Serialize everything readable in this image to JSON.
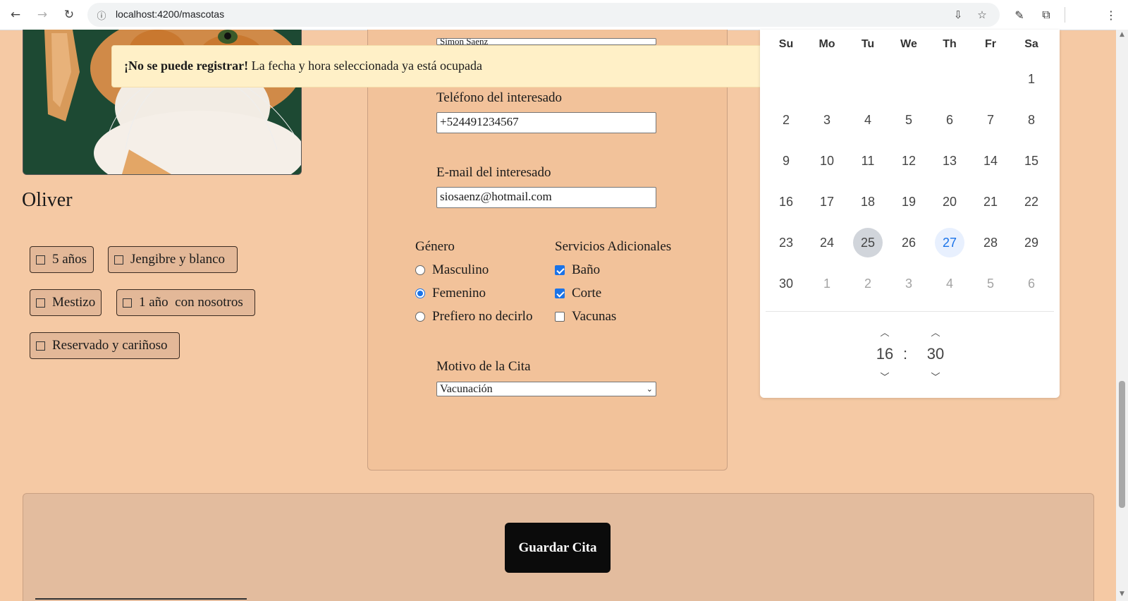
{
  "browser": {
    "url": "localhost:4200/mascotas",
    "back_glyph": "←",
    "forward_glyph": "→",
    "reload_glyph": "↻",
    "info_glyph": "ⓘ",
    "install_glyph": "⇩",
    "bookmark_glyph": "☆",
    "eyedropper_glyph": "✎",
    "extensions_glyph": "⧉",
    "menu_glyph": "⋮",
    "icons": [
      "back-icon",
      "forward-icon",
      "reload-icon",
      "site-info-icon",
      "install-icon",
      "bookmark-star-icon",
      "eyedropper-icon",
      "extensions-icon",
      "menu-icon"
    ]
  },
  "pet": {
    "name": "Oliver",
    "traits": [
      "5 años",
      "Jengibre y blanco",
      "Mestizo",
      "1 año  con nosotros",
      "Reservado y cariñoso"
    ]
  },
  "alert": {
    "title": "¡No se puede registrar!",
    "message": "La fecha y hora seleccionada ya está ocupada",
    "close_glyph": "✕",
    "color_bg": "#fff0c7"
  },
  "form": {
    "partial_value": "Simon Saenz",
    "phone_label": "Teléfono del interesado",
    "phone_value": "+524491234567",
    "email_label": "E-mail del interesado",
    "email_value": "siosaenz@hotmail.com",
    "gender_label": "Género",
    "gender_options": [
      {
        "label": "Masculino",
        "checked": false
      },
      {
        "label": "Femenino",
        "checked": true
      },
      {
        "label": "Prefiero no decirlo",
        "checked": false
      }
    ],
    "services_label": "Servicios Adicionales",
    "services_options": [
      {
        "label": "Baño",
        "checked": true
      },
      {
        "label": "Corte",
        "checked": true
      },
      {
        "label": "Vacunas",
        "checked": false
      }
    ],
    "reason_label": "Motivo de la Cita",
    "reason_value": "Vacunación",
    "reason_chevron": "⌄"
  },
  "calendar": {
    "weekdays": [
      "Su",
      "Mo",
      "Tu",
      "We",
      "Th",
      "Fr",
      "Sa"
    ],
    "weeks": [
      [
        "",
        "",
        "",
        "",
        "",
        "",
        "1"
      ],
      [
        "2",
        "3",
        "4",
        "5",
        "6",
        "7",
        "8"
      ],
      [
        "9",
        "10",
        "11",
        "12",
        "13",
        "14",
        "15"
      ],
      [
        "16",
        "17",
        "18",
        "19",
        "20",
        "21",
        "22"
      ],
      [
        "23",
        "24",
        "25",
        "26",
        "27",
        "28",
        "29"
      ],
      [
        "30",
        "1",
        "2",
        "3",
        "4",
        "5",
        "6"
      ]
    ],
    "selected_day": "25",
    "highlighted_day": "27",
    "hour": "16",
    "minute": "30",
    "time_separator": ":",
    "up_glyph": "︿",
    "down_glyph": "﹀",
    "accent_color": "#1a73e8"
  },
  "footer": {
    "save_label": "Guardar Cita"
  },
  "colors": {
    "page_bg": "#f5c9a4",
    "panel_bg": "#f2c29a",
    "footer_bg": "#e3bc9e",
    "button_bg": "#0b0b0b"
  }
}
